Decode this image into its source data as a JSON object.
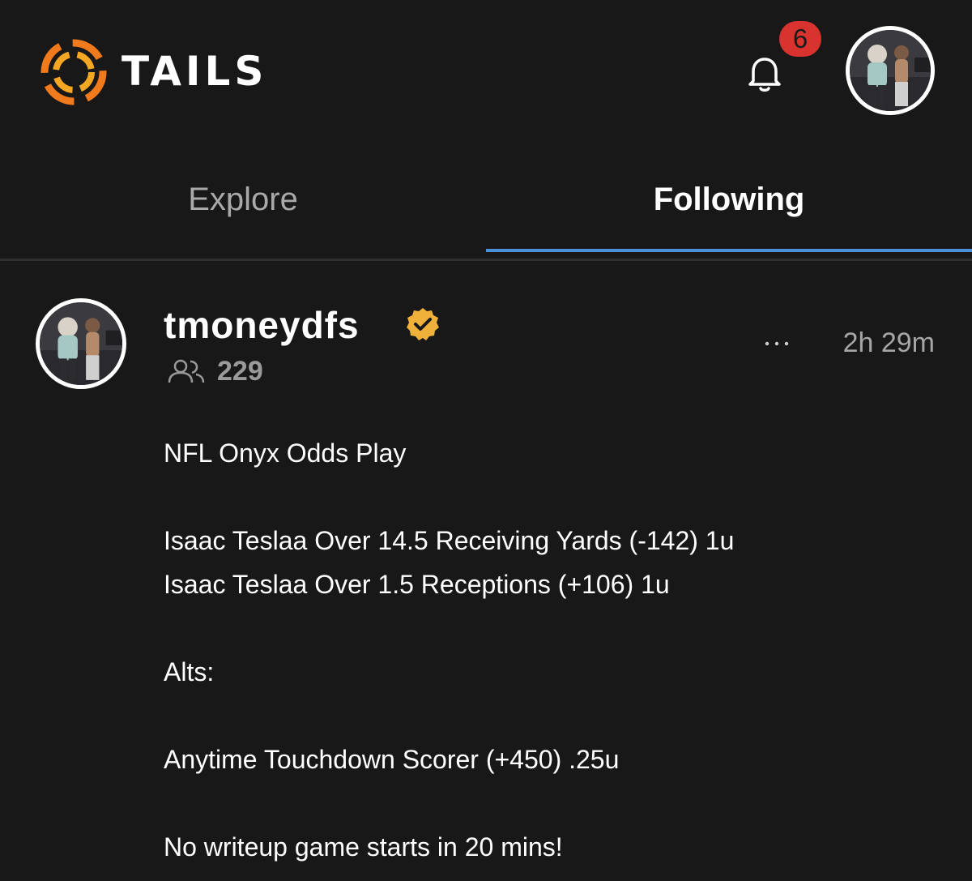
{
  "header": {
    "brand_name": "TAILS",
    "logo_icon": "tails-flame-logo-icon",
    "notification_icon": "bell-icon",
    "notification_count": "6",
    "profile_avatar": "user-avatar"
  },
  "colors": {
    "background": "#181818",
    "accent_tab_underline": "#4a90d9",
    "badge": "#d9332f",
    "verified": "#f0b13b",
    "logo_orange": "#f07a1c"
  },
  "tabs": [
    {
      "label": "Explore",
      "active": false
    },
    {
      "label": "Following",
      "active": true
    }
  ],
  "post": {
    "username": "tmoneydfs",
    "verified": true,
    "verified_icon": "verified-badge-icon",
    "followers_icon": "people-icon",
    "followers_count": "229",
    "more_icon": "ellipsis-icon",
    "timestamp": "2h 29m",
    "lines": [
      "NFL Onyx Odds Play",
      "Isaac Teslaa Over 14.5 Receiving Yards (-142) 1u",
      "Isaac Teslaa Over 1.5 Receptions (+106) 1u",
      "Alts:",
      "Anytime Touchdown Scorer (+450) .25u",
      "No writeup game starts in 20 mins!"
    ]
  }
}
